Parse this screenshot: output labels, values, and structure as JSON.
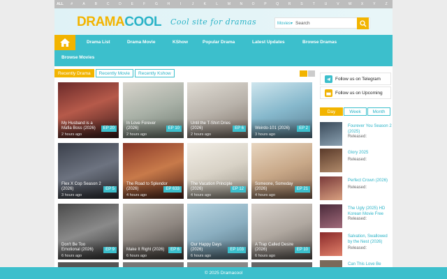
{
  "alphabet": [
    "ALL",
    "#",
    "A",
    "B",
    "C",
    "D",
    "E",
    "F",
    "G",
    "H",
    "I",
    "J",
    "K",
    "L",
    "M",
    "N",
    "O",
    "P",
    "Q",
    "R",
    "S",
    "T",
    "U",
    "V",
    "W",
    "X",
    "Y",
    "Z"
  ],
  "logo": {
    "part1": "DRAMA",
    "part2": "COOL"
  },
  "tagline": "Cool site for dramas",
  "search": {
    "scope": "Movies",
    "placeholder": "Search"
  },
  "nav": {
    "items": [
      "Drama List",
      "Drama Movie",
      "KShow",
      "Popular Drama",
      "Latest Updates",
      "Browse Dramas"
    ],
    "second_row": "Browse Movies"
  },
  "tabs": [
    "Recently Drama",
    "Recently Movie",
    "Recently Kshow"
  ],
  "cards": [
    {
      "title": "My Husband is a Mafia Boss (2026)",
      "time": "2 hours ago",
      "ep": "EP 20"
    },
    {
      "title": "In Love Forever (2026)",
      "time": "2 hours ago",
      "ep": "EP 10"
    },
    {
      "title": "Until the T-Shirt Dries (2026)",
      "time": "2 hours ago",
      "ep": "EP 6"
    },
    {
      "title": "Weirdo-101 (2026)",
      "time": "3 hours ago",
      "ep": "EP 2"
    },
    {
      "title": "Flex X Cop Season 2 (2026)",
      "time": "3 hours ago",
      "ep": "EP 5"
    },
    {
      "title": "The Road to Splendor (2026)",
      "time": "4 hours ago",
      "ep": "EP 633"
    },
    {
      "title": "The Vacation Principle (2026)",
      "time": "4 hours ago",
      "ep": "EP 12"
    },
    {
      "title": "Someone, Someday (2026)",
      "time": "4 hours ago",
      "ep": "EP 21"
    },
    {
      "title": "Don't Be Too Emotional (2026)",
      "time": "6 hours ago",
      "ep": "EP 9"
    },
    {
      "title": "Make It Right (2026)",
      "time": "6 hours ago",
      "ep": "EP 6"
    },
    {
      "title": "Our Happy Days (2026)",
      "time": "6 hours ago",
      "ep": "EP 103"
    },
    {
      "title": "A Trap Called Desire (2026)",
      "time": "6 hours ago",
      "ep": "EP 10"
    }
  ],
  "follow": {
    "telegram": "Follow us on Telegram",
    "upcoming": "Follow us on Upcoming"
  },
  "popular_tabs": [
    "Day",
    "Week",
    "Month"
  ],
  "popular": [
    {
      "title": "Fourever You Season 2 (2025)",
      "released": "Released:"
    },
    {
      "title": "Glory 2025",
      "released": "Released:"
    },
    {
      "title": "Perfect Crown (2026)",
      "released": "Released:"
    },
    {
      "title": "The Ugly (2025) HD Korean Movie Free",
      "released": "Released:"
    },
    {
      "title": "Salvation, Swallowed by the Nest (2026)",
      "released": "Released:"
    },
    {
      "title": "Can This Love Be",
      "released": ""
    }
  ],
  "footer": "© 2025 Dramacool",
  "colors": {
    "accent": "#3cbfcc",
    "brand_yellow": "#f2b400"
  }
}
